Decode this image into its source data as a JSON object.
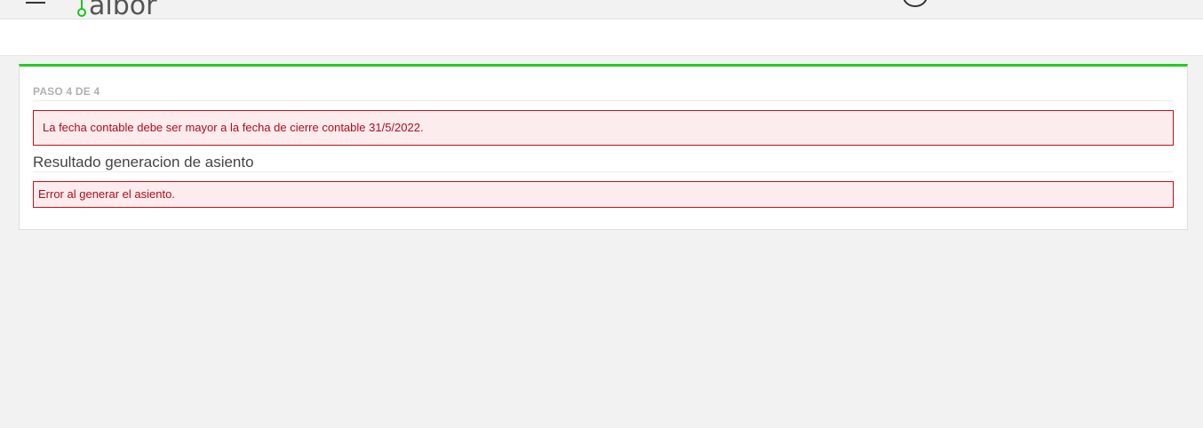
{
  "header": {
    "menu_icon": "hamburger-menu-icon",
    "logo_text": "albor",
    "logo_color": "#1ec31e",
    "user_icon": "user-avatar-icon",
    "user_text": ""
  },
  "wizard": {
    "step_label": "PASO 4 DE 4",
    "accent_color": "#22cc22",
    "error_date_message": "La fecha contable debe ser mayor a la fecha de cierre contable 31/5/2022.",
    "result_title": "Resultado generacion de asiento",
    "result_error_message": "Error al generar el asiento.",
    "error_color": "#c0101c",
    "error_bg": "#fdecee"
  }
}
